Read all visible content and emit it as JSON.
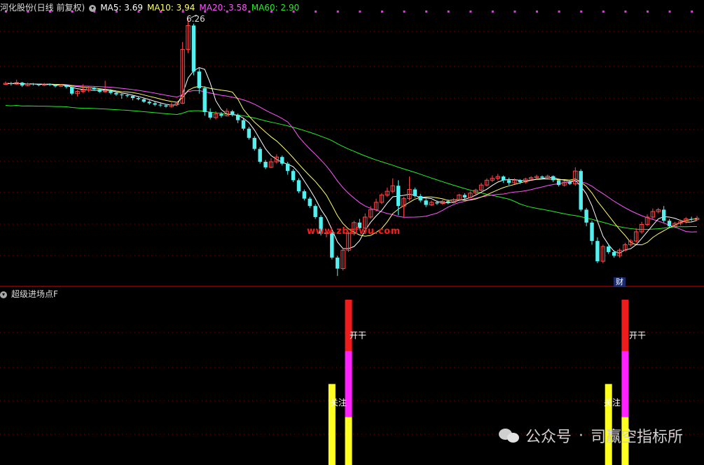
{
  "header": {
    "stock_title": "河化股份(日线 前复权)",
    "ma5": "MA5: 3.69",
    "ma10": "MA10: 3.94",
    "ma20": "MA20: 3.58",
    "ma60": "MA60: 2.90",
    "colors": {
      "ma5": "#ffffff",
      "ma10": "#ffff66",
      "ma20": "#ff55ff",
      "ma60": "#22ee22"
    }
  },
  "price_chart": {
    "high_label": "6.26",
    "watermark": "www.zbzfwu.com",
    "finance_badge": "财"
  },
  "indicator": {
    "title": "超级进场点F",
    "label_watch": "关注",
    "label_open": "开干",
    "colors": {
      "red": "#ee1c1c",
      "magenta": "#ff22ff",
      "yellow": "#ffff22"
    }
  },
  "footer": {
    "account_prefix": "公众号",
    "separator": "·",
    "account_name": "司赢空指标所"
  },
  "chart_data": {
    "type": "candlestick",
    "note_colors": {
      "up": "#ff4a4a",
      "down": "#54f0f0"
    },
    "candles": [
      [
        4.45,
        4.48,
        4.53,
        4.43
      ],
      [
        4.48,
        4.46,
        4.52,
        4.42
      ],
      [
        4.46,
        4.5,
        4.58,
        4.44
      ],
      [
        4.5,
        4.42,
        4.52,
        4.38
      ],
      [
        4.42,
        4.47,
        4.5,
        4.4
      ],
      [
        4.47,
        4.45,
        4.49,
        4.42
      ],
      [
        4.45,
        4.43,
        4.47,
        4.4
      ],
      [
        4.43,
        4.46,
        4.49,
        4.41
      ],
      [
        4.46,
        4.44,
        4.48,
        4.41
      ],
      [
        4.44,
        4.4,
        4.46,
        4.37
      ],
      [
        4.4,
        4.43,
        4.46,
        4.38
      ],
      [
        4.43,
        4.38,
        4.45,
        4.34
      ],
      [
        4.38,
        4.2,
        4.4,
        4.16
      ],
      [
        4.2,
        4.26,
        4.3,
        4.12
      ],
      [
        4.26,
        4.3,
        4.45,
        4.22
      ],
      [
        4.3,
        4.36,
        4.4,
        4.24
      ],
      [
        4.36,
        4.32,
        4.38,
        4.28
      ],
      [
        4.32,
        4.25,
        4.34,
        4.22
      ],
      [
        4.25,
        4.27,
        4.55,
        4.22
      ],
      [
        4.27,
        4.22,
        4.32,
        4.18
      ],
      [
        4.22,
        4.18,
        4.25,
        4.14
      ],
      [
        4.18,
        4.16,
        4.2,
        4.06
      ],
      [
        4.16,
        4.14,
        4.18,
        4.1
      ],
      [
        4.14,
        4.08,
        4.16,
        4.02
      ],
      [
        4.08,
        4.05,
        4.12,
        4.02
      ],
      [
        4.05,
        3.98,
        4.08,
        3.95
      ],
      [
        3.98,
        3.94,
        4.02,
        3.9
      ],
      [
        3.94,
        3.9,
        3.98,
        3.86
      ],
      [
        3.9,
        3.88,
        3.94,
        3.84
      ],
      [
        3.88,
        3.85,
        3.92,
        3.82
      ],
      [
        3.85,
        3.9,
        3.96,
        3.82
      ],
      [
        3.9,
        3.94,
        3.98,
        3.86
      ],
      [
        3.94,
        5.4,
        5.6,
        3.92
      ],
      [
        5.4,
        6.05,
        6.26,
        5.3
      ],
      [
        6.05,
        4.8,
        6.1,
        4.7
      ],
      [
        4.8,
        4.35,
        4.9,
        4.2
      ],
      [
        4.35,
        3.7,
        4.4,
        3.6
      ],
      [
        3.7,
        3.55,
        3.8,
        3.5
      ],
      [
        3.55,
        3.65,
        3.72,
        3.5
      ],
      [
        3.65,
        3.6,
        3.7,
        3.55
      ],
      [
        3.6,
        3.72,
        3.8,
        3.58
      ],
      [
        3.72,
        3.62,
        3.76,
        3.58
      ],
      [
        3.62,
        3.48,
        3.66,
        3.4
      ],
      [
        3.48,
        3.25,
        3.52,
        3.2
      ],
      [
        3.25,
        3.0,
        3.3,
        2.95
      ],
      [
        3.0,
        2.7,
        3.05,
        2.65
      ],
      [
        2.7,
        2.35,
        2.75,
        2.3
      ],
      [
        2.35,
        2.2,
        2.4,
        2.15
      ],
      [
        2.2,
        2.35,
        2.45,
        2.18
      ],
      [
        2.35,
        2.48,
        2.55,
        2.3
      ],
      [
        2.48,
        2.3,
        2.52,
        2.25
      ],
      [
        2.3,
        2.1,
        2.35,
        2.0
      ],
      [
        2.1,
        1.85,
        2.15,
        1.8
      ],
      [
        1.85,
        1.55,
        1.9,
        1.5
      ],
      [
        1.55,
        1.35,
        1.6,
        1.3
      ],
      [
        1.35,
        1.15,
        1.4,
        1.1
      ],
      [
        1.15,
        0.85,
        1.2,
        0.8
      ],
      [
        0.85,
        0.4,
        0.9,
        0.35
      ],
      [
        0.4,
        0.42,
        0.5,
        0.3
      ],
      [
        0.42,
        -0.25,
        0.45,
        -0.3
      ],
      [
        -0.25,
        -0.55,
        -0.2,
        -0.75
      ],
      [
        -0.55,
        -0.05,
        0.0,
        -0.6
      ],
      [
        -0.05,
        0.4,
        0.45,
        -0.1
      ],
      [
        0.4,
        0.7,
        0.75,
        0.35
      ],
      [
        0.7,
        0.55,
        0.8,
        0.5
      ],
      [
        0.55,
        0.85,
        0.95,
        0.5
      ],
      [
        0.85,
        1.05,
        1.15,
        0.8
      ],
      [
        1.05,
        1.25,
        1.35,
        1.0
      ],
      [
        1.25,
        1.45,
        1.5,
        1.2
      ],
      [
        1.45,
        1.55,
        1.65,
        1.4
      ],
      [
        1.55,
        1.7,
        1.9,
        1.5
      ],
      [
        1.7,
        1.15,
        1.85,
        0.9
      ],
      [
        1.15,
        1.35,
        1.4,
        0.85
      ],
      [
        1.35,
        1.6,
        1.95,
        1.3
      ],
      [
        1.6,
        1.42,
        1.65,
        1.38
      ],
      [
        1.42,
        1.3,
        1.48,
        1.25
      ],
      [
        1.3,
        1.18,
        1.35,
        1.12
      ],
      [
        1.18,
        1.25,
        1.3,
        1.15
      ],
      [
        1.25,
        1.22,
        1.3,
        1.18
      ],
      [
        1.22,
        1.28,
        1.32,
        1.18
      ],
      [
        1.28,
        1.24,
        1.33,
        1.2
      ],
      [
        1.24,
        1.32,
        1.36,
        1.22
      ],
      [
        1.32,
        1.45,
        1.48,
        1.28
      ],
      [
        1.45,
        1.38,
        1.5,
        1.32
      ],
      [
        1.38,
        1.5,
        1.55,
        1.36
      ],
      [
        1.5,
        1.58,
        1.62,
        1.45
      ],
      [
        1.58,
        1.72,
        1.78,
        1.55
      ],
      [
        1.72,
        1.85,
        1.9,
        1.68
      ],
      [
        1.85,
        1.9,
        1.98,
        1.8
      ],
      [
        1.9,
        1.95,
        2.02,
        1.85
      ],
      [
        1.95,
        1.85,
        1.98,
        1.78
      ],
      [
        1.85,
        1.78,
        1.92,
        1.72
      ],
      [
        1.78,
        1.85,
        1.9,
        1.74
      ],
      [
        1.85,
        1.8,
        1.88,
        1.75
      ],
      [
        1.8,
        1.88,
        1.92,
        1.76
      ],
      [
        1.88,
        1.92,
        1.96,
        1.85
      ],
      [
        1.92,
        1.95,
        2.0,
        1.88
      ],
      [
        1.95,
        1.92,
        1.98,
        1.88
      ],
      [
        1.92,
        1.96,
        2.0,
        1.9
      ],
      [
        1.96,
        1.85,
        1.98,
        1.8
      ],
      [
        1.85,
        1.72,
        1.88,
        1.68
      ],
      [
        1.72,
        1.8,
        1.84,
        1.68
      ],
      [
        1.8,
        1.75,
        1.86,
        1.72
      ],
      [
        1.75,
        2.1,
        2.2,
        1.7
      ],
      [
        2.1,
        1.05,
        2.15,
        1.0
      ],
      [
        1.05,
        0.7,
        1.1,
        0.6
      ],
      [
        0.7,
        0.2,
        0.75,
        0.1
      ],
      [
        0.2,
        -0.35,
        0.3,
        -0.4
      ],
      [
        -0.35,
        0.05,
        0.1,
        -0.4
      ],
      [
        0.05,
        -0.1,
        0.12,
        -0.15
      ],
      [
        -0.1,
        -0.2,
        -0.05,
        -0.25
      ],
      [
        -0.2,
        -0.05,
        0.0,
        -0.25
      ],
      [
        -0.05,
        0.1,
        0.15,
        -0.08
      ],
      [
        0.1,
        0.2,
        0.25,
        0.05
      ],
      [
        0.2,
        0.45,
        0.55,
        0.15
      ],
      [
        0.45,
        0.65,
        0.72,
        0.4
      ],
      [
        0.65,
        0.85,
        0.92,
        0.6
      ],
      [
        0.85,
        1.0,
        1.08,
        0.8
      ],
      [
        1.0,
        1.05,
        1.1,
        0.95
      ],
      [
        1.05,
        0.75,
        1.15,
        0.7
      ],
      [
        0.75,
        0.6,
        0.8,
        0.55
      ],
      [
        0.6,
        0.68,
        0.72,
        0.55
      ],
      [
        0.68,
        0.72,
        0.78,
        0.62
      ],
      [
        0.72,
        0.8,
        0.85,
        0.68
      ],
      [
        0.8,
        0.78,
        0.86,
        0.74
      ],
      [
        0.78,
        0.82,
        0.88,
        0.75
      ]
    ],
    "signals": [
      {
        "index": 59,
        "watch_top": 0.6,
        "open_top": 0.0
      },
      {
        "index": 62,
        "watch_top": 0.8,
        "open_top": 0.0
      },
      {
        "index": 109,
        "watch_top": 0.6,
        "open_top": 0.0
      },
      {
        "index": 112,
        "watch_top": 0.8,
        "open_top": 0.0
      }
    ]
  }
}
